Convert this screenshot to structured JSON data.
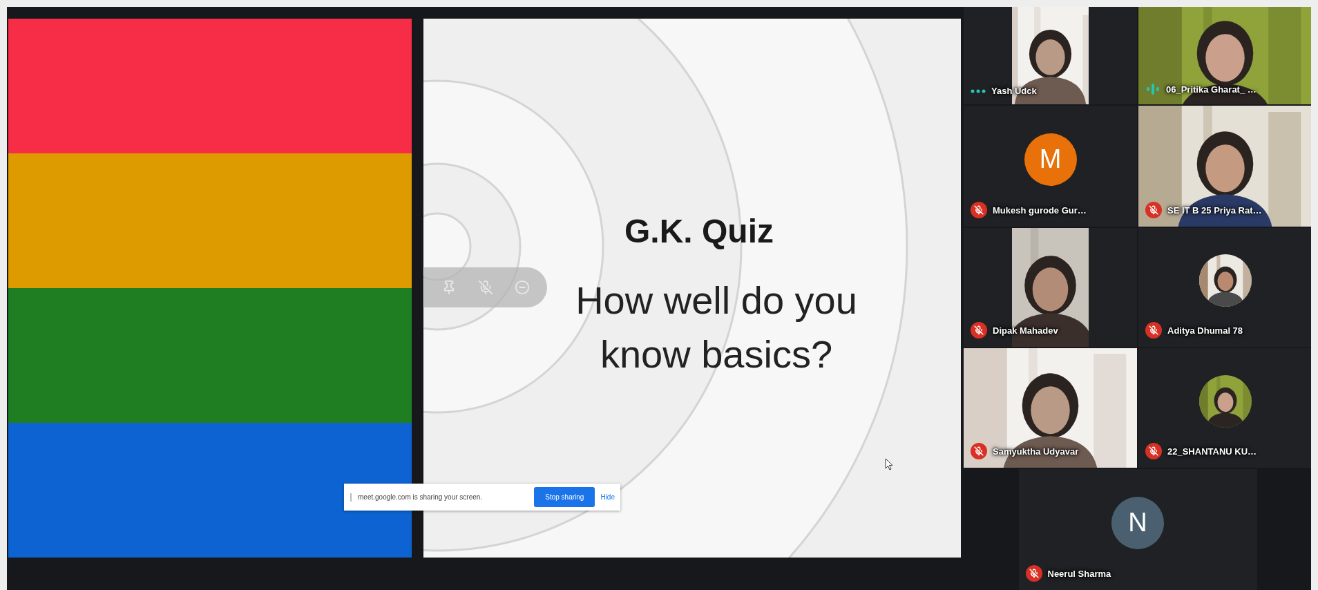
{
  "presentation": {
    "stripes": [
      {
        "color": "#f72d47"
      },
      {
        "color": "#de9b00"
      },
      {
        "color": "#1f7e22"
      },
      {
        "color": "#0d63d2"
      }
    ],
    "slide": {
      "title": "G.K. Quiz",
      "subtitle": "How well do you know basics?"
    }
  },
  "share_notice": {
    "message": "meet.google.com is sharing your screen.",
    "stop_button": "Stop sharing",
    "hide_link": "Hide"
  },
  "participants": [
    {
      "name": "Yash Udck",
      "kind": "video",
      "portrait": true,
      "muted": false,
      "speaking": false
    },
    {
      "name": "06_Pritika Gharat_ …",
      "kind": "video",
      "portrait": false,
      "muted": false,
      "speaking": true
    },
    {
      "name": "Mukesh gurode Gur…",
      "kind": "initial",
      "initial": "M",
      "color": "#e8710a",
      "muted": true,
      "speaking": false
    },
    {
      "name": "SE IT B 25 Priya Rat…",
      "kind": "video",
      "portrait": false,
      "muted": true,
      "speaking": false
    },
    {
      "name": "Dipak Mahadev",
      "kind": "video",
      "portrait": true,
      "muted": true,
      "speaking": false
    },
    {
      "name": "Aditya Dhumal 78",
      "muted": true,
      "speaking": false
    },
    {
      "name": "Samyuktha Udyavar",
      "kind": "video",
      "portrait": false,
      "muted": true,
      "speaking": false
    },
    {
      "name": "22_SHANTANU KU…",
      "muted": true,
      "speaking": false
    },
    {
      "name": "Neerul Sharma",
      "kind": "initial",
      "initial": "N",
      "color": "#4a6070",
      "muted": true,
      "speaking": false
    }
  ]
}
